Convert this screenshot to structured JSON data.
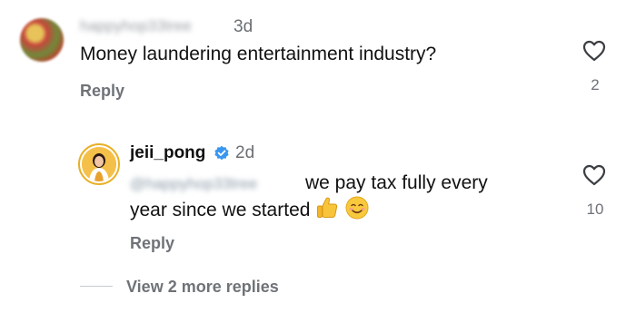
{
  "comments": [
    {
      "username": "happyhop33tree",
      "time": "3d",
      "text": "Money laundering entertainment industry?",
      "reply_label": "Reply",
      "likes": "2"
    },
    {
      "username": "jeii_pong",
      "verified": true,
      "time": "2d",
      "mention": "@happyhop33tree",
      "text_line1": "we pay tax fully every",
      "text_line2": "year since we started",
      "emojis": [
        "thumbs-up",
        "smiling-face"
      ],
      "reply_label": "Reply",
      "likes": "10"
    }
  ],
  "view_more_label": "View 2 more replies",
  "colors": {
    "text": "#111111",
    "secondary": "#6f7378",
    "verified_blue": "#3897f0",
    "avatar_ring": "#e9b027"
  }
}
